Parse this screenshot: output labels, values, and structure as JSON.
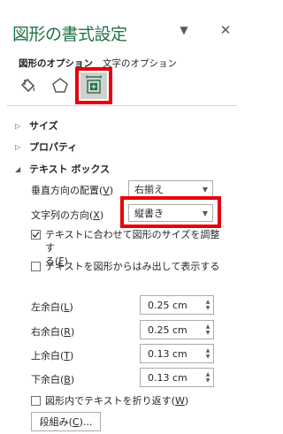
{
  "pane": {
    "title": "図形の書式設定",
    "dropdown_icon": "chevron-down-icon",
    "close_icon": "close-icon"
  },
  "tabs": [
    {
      "label": "図形のオプション",
      "active": true
    },
    {
      "label": "文字のオプション",
      "active": false
    }
  ],
  "icons": [
    {
      "name": "fill-bucket-icon",
      "selected": false
    },
    {
      "name": "pentagon-effects-icon",
      "selected": false
    },
    {
      "name": "size-properties-icon",
      "selected": true
    }
  ],
  "sections": {
    "size": "サイズ",
    "properties": "プロパティ",
    "textbox": "テキスト ボックス"
  },
  "textbox": {
    "vertical_align": {
      "label": "垂直方向の配置",
      "key": "V",
      "value": "右揃え"
    },
    "text_direction": {
      "label": "文字列の方向",
      "key": "X",
      "value": "縦書き"
    },
    "autofit": {
      "label_line1": "テキストに合わせて図形のサイズを調整す",
      "label_line2": "る",
      "key": "F",
      "checked": true
    },
    "overflow": {
      "label": "テキストを図形からはみ出して表示する",
      "checked": false
    },
    "margins": [
      {
        "label": "左余白",
        "key": "L",
        "value": "0.25 cm"
      },
      {
        "label": "右余白",
        "key": "R",
        "value": "0.25 cm"
      },
      {
        "label": "上余白",
        "key": "T",
        "value": "0.13 cm"
      },
      {
        "label": "下余白",
        "key": "B",
        "value": "0.13 cm"
      }
    ],
    "wrap": {
      "label": "図形内でテキストを折り返す",
      "key": "W",
      "checked": false
    },
    "columns_button": {
      "label": "段組み",
      "key": "C",
      "suffix": "..."
    }
  },
  "colors": {
    "title": "#217346",
    "highlight": "#e8000b"
  }
}
